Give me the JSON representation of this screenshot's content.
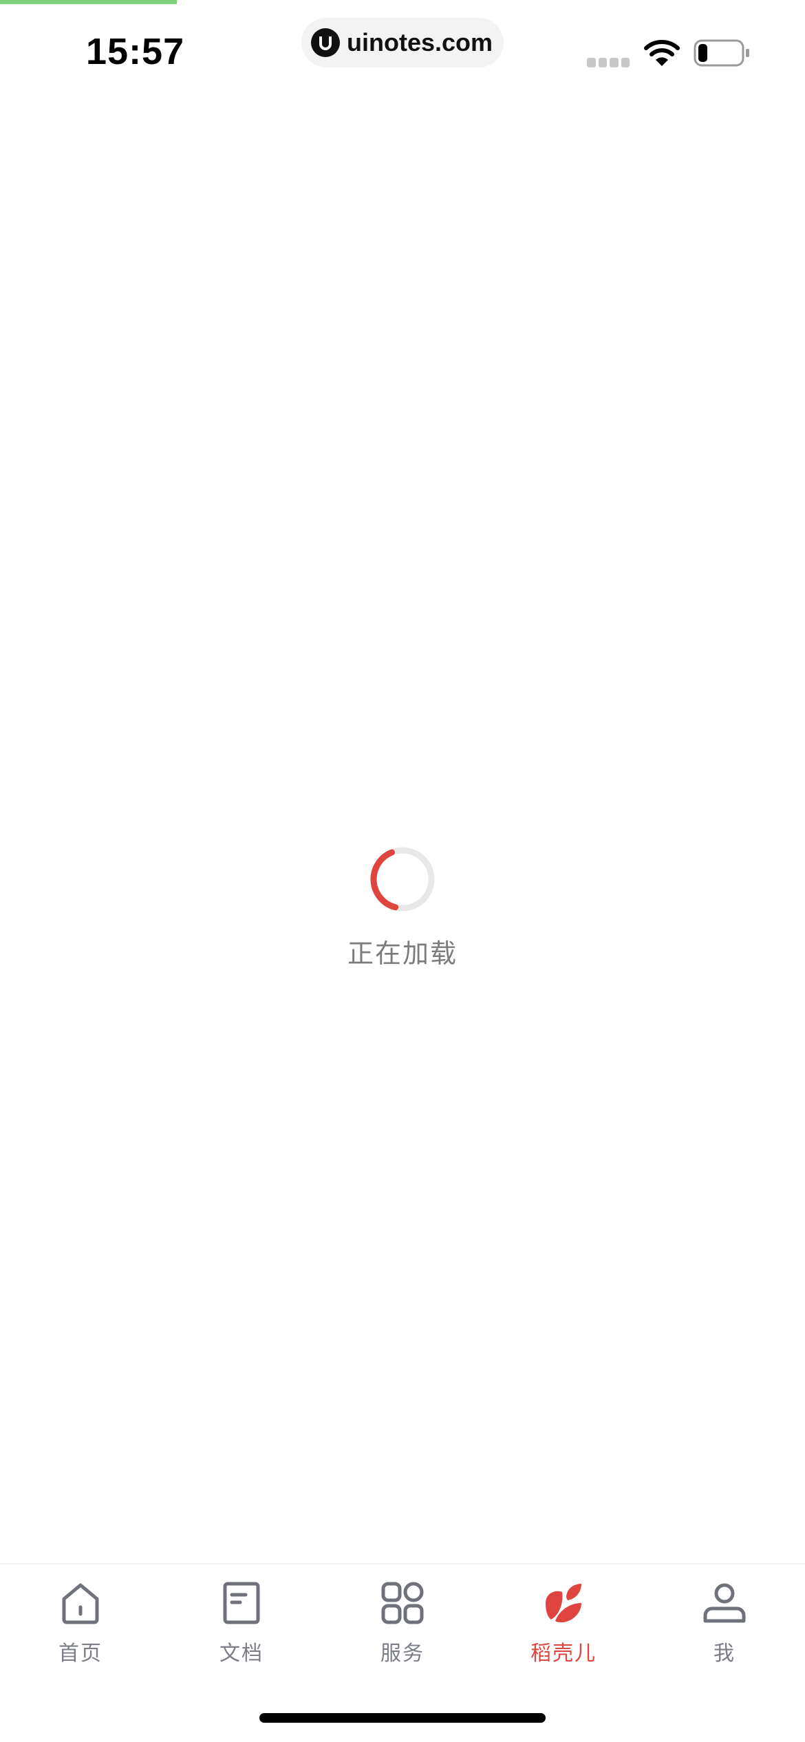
{
  "status_bar": {
    "time": "15:57",
    "url": "uinotes.com"
  },
  "page_load_progress": 0.22,
  "loading": {
    "text": "正在加载",
    "spinner_color": "#e0443e",
    "progress": 0.4
  },
  "tabs": [
    {
      "label": "首页",
      "icon": "home-icon",
      "active": false
    },
    {
      "label": "文档",
      "icon": "document-icon",
      "active": false
    },
    {
      "label": "服务",
      "icon": "grid-icon",
      "active": false
    },
    {
      "label": "稻壳儿",
      "icon": "leaf-icon",
      "active": true
    },
    {
      "label": "我",
      "icon": "user-icon",
      "active": false
    }
  ],
  "colors": {
    "accent": "#e0443e",
    "inactive": "#7b7e86",
    "progress": "#7fd27a"
  }
}
